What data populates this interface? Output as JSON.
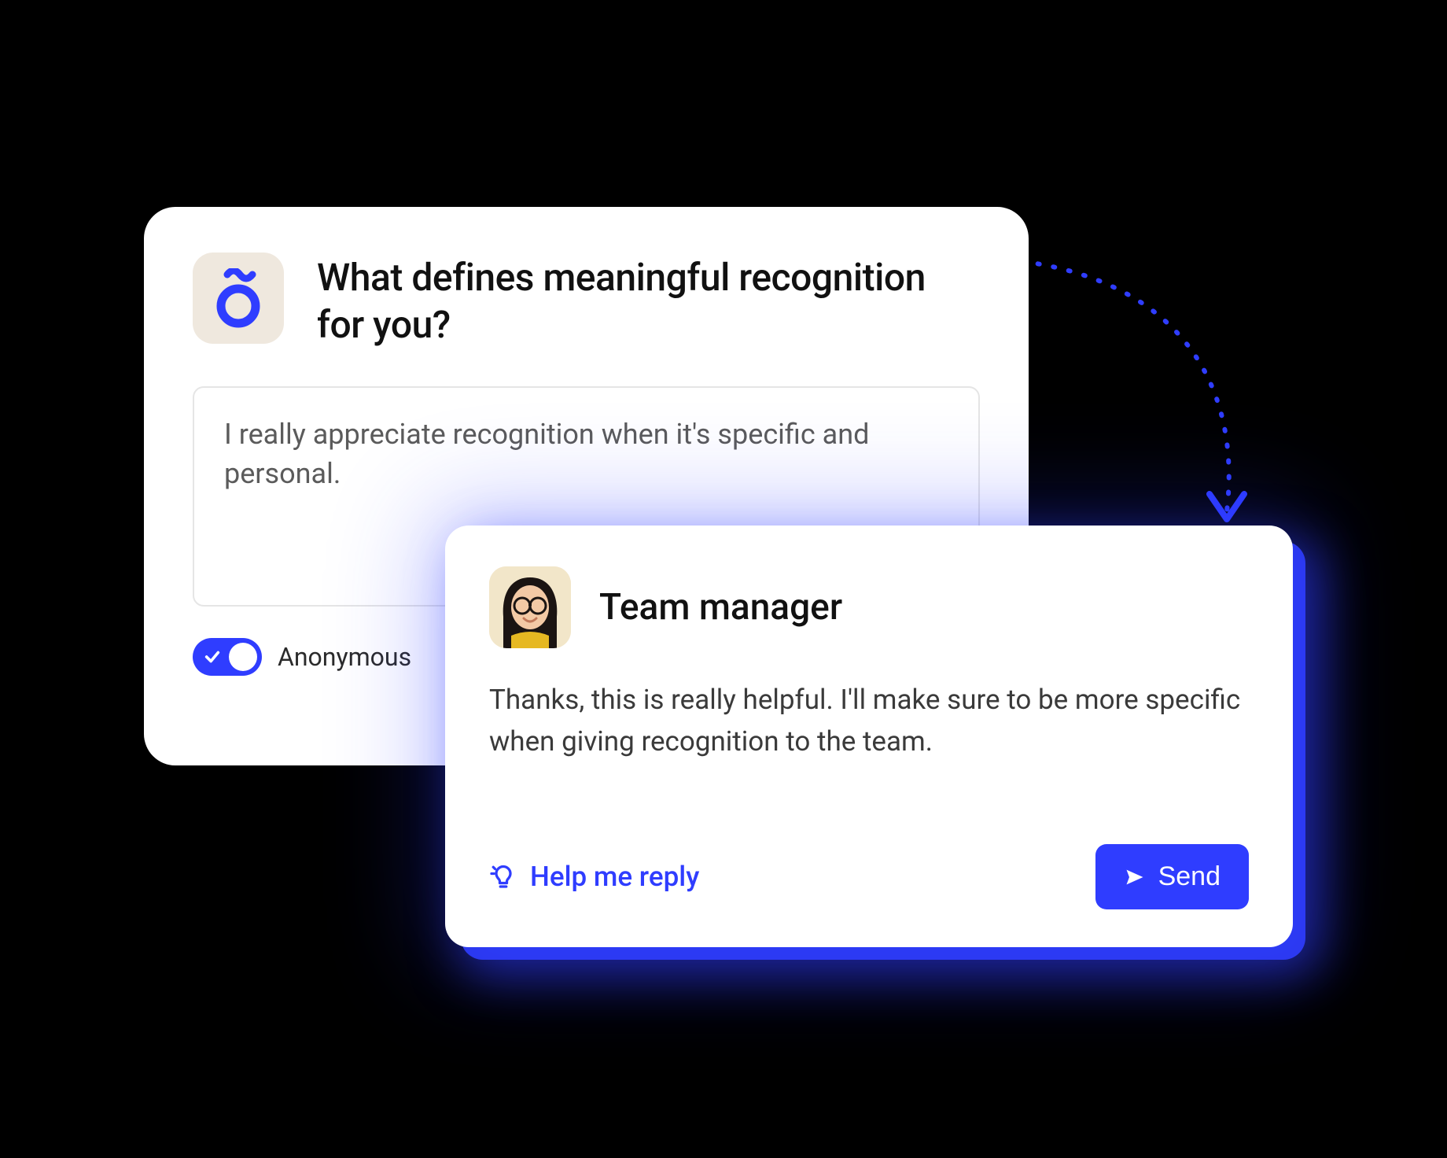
{
  "colors": {
    "accent": "#2F3DFF",
    "logoBg": "#EFE8DE"
  },
  "question": {
    "title": "What defines meaningful recognition for you?",
    "response": "I really appreciate recognition when it's specific and personal.",
    "anonymousToggle": {
      "on": true,
      "label": "Anonymous"
    }
  },
  "reply": {
    "authorRole": "Team manager",
    "body": "Thanks, this is really helpful. I'll make sure to be more specific when giving recognition to the team.",
    "helpLabel": "Help me reply",
    "sendLabel": "Send"
  }
}
